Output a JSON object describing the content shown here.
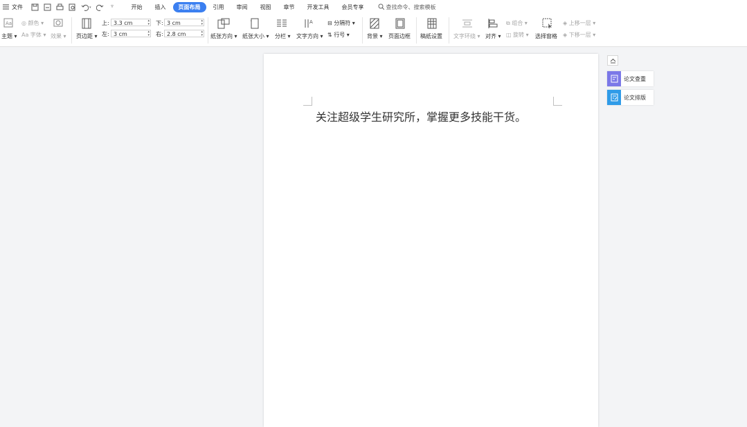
{
  "menu": {
    "file_label": "文件",
    "tabs": [
      "开始",
      "插入",
      "页面布局",
      "引用",
      "审阅",
      "视图",
      "章节",
      "开发工具",
      "会员专享"
    ],
    "active_tab": "页面布局",
    "search_placeholder": "查找命令、搜索模板"
  },
  "ribbon": {
    "theme": "主题",
    "colors": "颜色",
    "fonts": "字体",
    "effects": "效果",
    "margins": "页边距",
    "margin_top_label": "上:",
    "margin_top_value": "3.3 cm",
    "margin_bottom_label": "下:",
    "margin_bottom_value": "3 cm",
    "margin_left_label": "左:",
    "margin_left_value": "3 cm",
    "margin_right_label": "右:",
    "margin_right_value": "2.8 cm",
    "orientation": "纸张方向",
    "size": "纸张大小",
    "columns": "分栏",
    "text_direction": "文字方向",
    "breaks": "分隔符",
    "line_numbers": "行号",
    "background": "背景",
    "page_border": "页面边框",
    "manuscript": "稿纸设置",
    "text_wrap": "文字环绕",
    "align": "对齐",
    "group": "组合",
    "rotate": "旋转",
    "selection_pane": "选择窗格",
    "bring_forward": "上移一层",
    "send_backward": "下移一层"
  },
  "document": {
    "text": "关注超级学生研究所，掌握更多技能干货。"
  },
  "side_panel": {
    "check_label": "论文查重",
    "format_label": "论文排版",
    "check_color": "#7b78e8",
    "format_color": "#2f9be8"
  },
  "colors": {
    "accent": "#3b7ff0"
  }
}
